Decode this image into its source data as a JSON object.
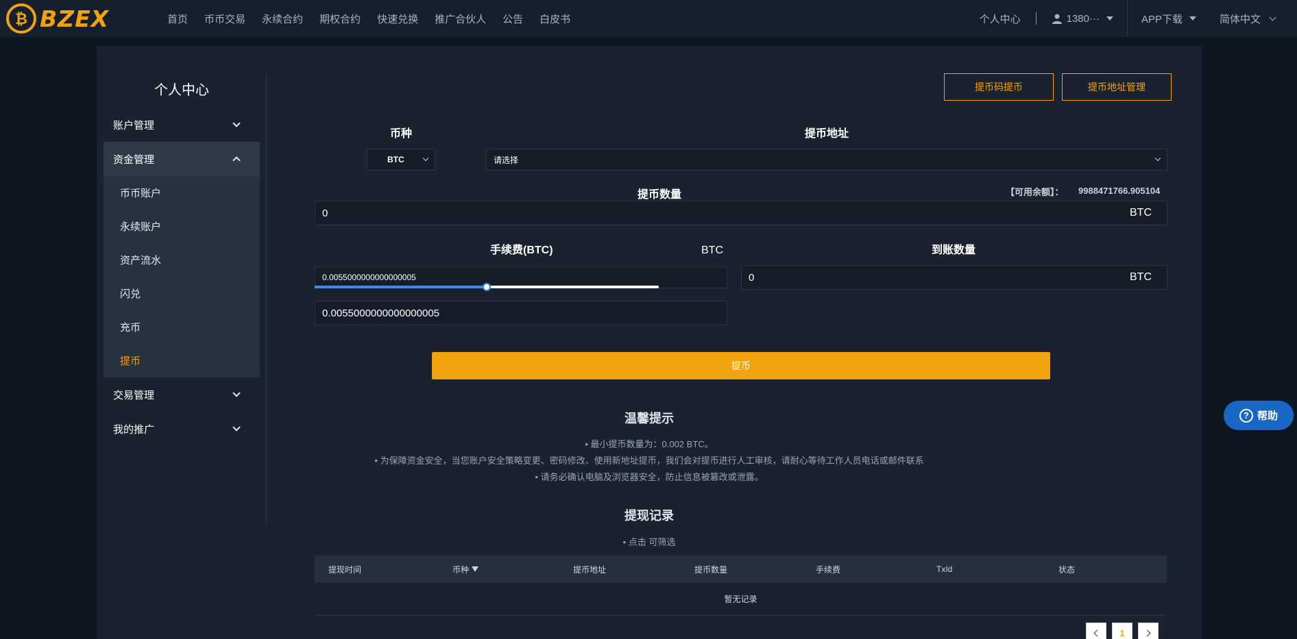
{
  "brand": {
    "name": "BZEX",
    "accent": "#f0a30c"
  },
  "nav": {
    "items": [
      "首页",
      "币币交易",
      "永续合约",
      "期权合约",
      "快速兑换",
      "推广合伙人",
      "公告",
      "白皮书"
    ],
    "personal_center": "个人中心",
    "user": "1380···",
    "app_download": "APP下载",
    "language": "简体中文"
  },
  "sidebar": {
    "title": "个人中心",
    "groups": [
      {
        "label": "账户管理"
      },
      {
        "label": "资金管理",
        "expanded": true,
        "items": [
          "币币账户",
          "永续账户",
          "资产流水",
          "闪兑",
          "充币",
          "提币"
        ],
        "active": "提币"
      },
      {
        "label": "交易管理"
      },
      {
        "label": "我的推广"
      }
    ]
  },
  "actions": {
    "code_withdraw": "提币码提币",
    "address_manage": "提币地址管理"
  },
  "form": {
    "coin_label": "币种",
    "coin_value": "BTC",
    "address_label": "提币地址",
    "address_placeholder": "请选择",
    "amount_label": "提币数量",
    "balance_label": "【可用余额】：",
    "balance_value": "9988471766.905104",
    "amount_value": "0",
    "amount_unit": "BTC",
    "fee_label": "手续费(BTC)",
    "fee_unit": "BTC",
    "fee_value": "0.0055000000000000005",
    "fee_slider_fraction": 0.5,
    "receive_label": "到账数量",
    "receive_value": "0",
    "receive_unit": "BTC",
    "submit_label": "提币"
  },
  "tips": {
    "title": "温馨提示",
    "lines": [
      "• 最小提币数量为：0.002 BTC。",
      "• 为保障资金安全，当您账户安全策略变更、密码修改、使用新地址提币，我们会对提币进行人工审核，请耐心等待工作人员电话或邮件联系",
      "• 请务必确认电脑及浏览器安全，防止信息被篡改或泄露。"
    ]
  },
  "records": {
    "title": "提现记录",
    "hint": "• 点击 可筛选",
    "columns": [
      "提现时间",
      "币种",
      "提币地址",
      "提币数量",
      "手续费",
      "TxId",
      "状态"
    ],
    "empty": "暂无记录",
    "current_page": "1"
  },
  "help": {
    "label": "帮助",
    "symbol": "?"
  }
}
